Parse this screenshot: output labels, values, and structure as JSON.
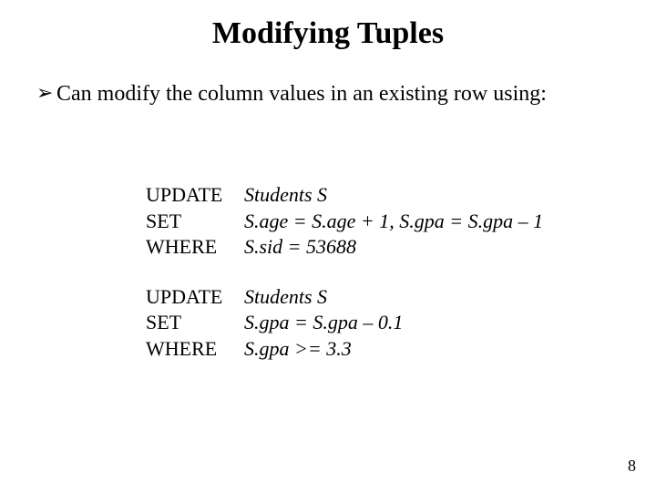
{
  "title": "Modifying Tuples",
  "bullet": {
    "marker": "➢",
    "text": "Can modify the column values in an existing row using:"
  },
  "code1": {
    "l1_kw": "UPDATE",
    "l1_rest": "Students S",
    "l2_kw": "SET",
    "l2_rest": "S.age = S.age + 1, S.gpa = S.gpa – 1",
    "l3_kw": "WHERE",
    "l3_rest": "S.sid = 53688"
  },
  "code2": {
    "l1_kw": "UPDATE",
    "l1_rest": "Students S",
    "l2_kw": "SET",
    "l2_rest": "S.gpa = S.gpa – 0.1",
    "l3_kw": "WHERE",
    "l3_rest": "S.gpa >= 3.3"
  },
  "page_number": "8"
}
